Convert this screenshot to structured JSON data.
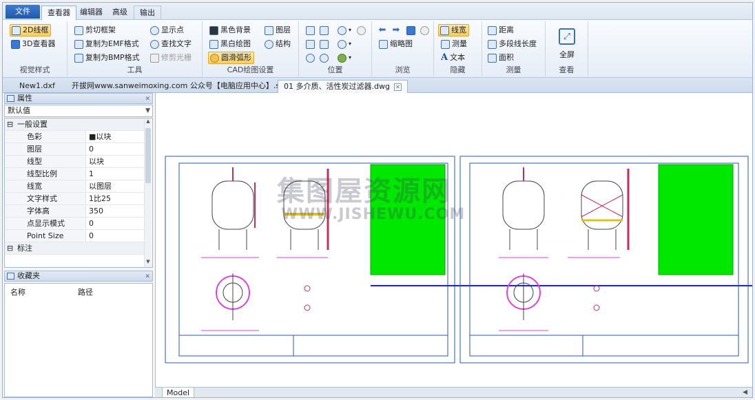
{
  "menu_tabs": [
    "文件",
    "查看器",
    "编辑器",
    "高级",
    "输出"
  ],
  "ribbon": {
    "visual_style": {
      "label": "视觉样式",
      "items": [
        "2D线框",
        "3D查看器"
      ]
    },
    "tools": {
      "label": "工具",
      "items": [
        "剪切框架",
        "复制为EMF格式",
        "复制为BMP格式",
        "显示点",
        "查找文字",
        "修剪光栅"
      ]
    },
    "cad_draw": {
      "label": "CAD绘图设置",
      "items": [
        "黑色背景",
        "黑白绘图",
        "圆滑弧形",
        "图层",
        "结构"
      ]
    },
    "position": {
      "label": "位置"
    },
    "browse": {
      "label": "浏览",
      "items": [
        "缩略图"
      ]
    },
    "hide": {
      "label": "隐藏",
      "items": [
        "线宽",
        "测量",
        "文本"
      ]
    },
    "measure": {
      "label": "测量",
      "items": [
        "距离",
        "多段线长度",
        "面积"
      ]
    },
    "view": {
      "label": "查看",
      "items": [
        "全屏"
      ]
    }
  },
  "doc_tabs": [
    "New1.dxf",
    "开拔网www.sanweimoxing.com 公众号【电脑应用中心】.step",
    "01 多介质、活性炭过滤器.dwg"
  ],
  "properties": {
    "title": "属性",
    "combo": "默认值",
    "rows": [
      {
        "k": "一般设置",
        "v": "",
        "sec": true
      },
      {
        "k": "色彩",
        "v": "■以块"
      },
      {
        "k": "图层",
        "v": "0"
      },
      {
        "k": "线型",
        "v": "以块"
      },
      {
        "k": "线型比例",
        "v": "1"
      },
      {
        "k": "线宽",
        "v": "以图层"
      },
      {
        "k": "文字样式",
        "v": "1比25"
      },
      {
        "k": "字体高",
        "v": "350"
      },
      {
        "k": "点显示模式",
        "v": "0"
      },
      {
        "k": "Point Size",
        "v": "0"
      },
      {
        "k": "标注",
        "v": "",
        "sec": true
      }
    ]
  },
  "favorites": {
    "title": "收藏夹",
    "col_name": "名称",
    "col_path": "路径"
  },
  "model_tab": "Model",
  "watermark": {
    "cn": "集图屋资源网",
    "en": "WWW.JISHEWU.COM"
  }
}
